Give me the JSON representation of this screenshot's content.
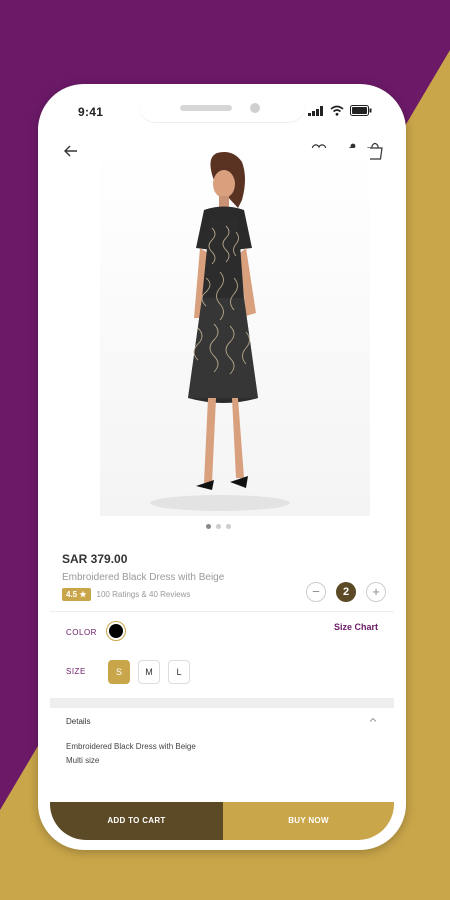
{
  "colors": {
    "background_purple": "#6c1a68",
    "gold": "#c9a64a",
    "dark_brown": "#5c4a26"
  },
  "status_bar": {
    "time": "9:41"
  },
  "header": {
    "back_icon": "arrow-left-icon",
    "icons": [
      "heart-icon",
      "share-icon",
      "shopping-bag-icon"
    ]
  },
  "gallery": {
    "image": "dress-model-photo",
    "dots": 3,
    "active_dot": 1
  },
  "product": {
    "price": "SAR 379.00",
    "name": "Embroidered Black Dress with Beige",
    "rating": "4.5 ★",
    "reviews": "100 Ratings & 40 Reviews"
  },
  "quantity": {
    "minus": "−",
    "value": "2",
    "plus": "+"
  },
  "color": {
    "label": "COLOR",
    "selected": "#000000",
    "size_chart": "Size Chart"
  },
  "size": {
    "label": "SIZE",
    "options": [
      "S",
      "M",
      "L"
    ],
    "selected": "S"
  },
  "details": {
    "title": "Details",
    "lines": [
      "Embroidered Black Dress with Beige",
      "Multi size"
    ]
  },
  "actions": {
    "add_to_cart": "ADD TO CART",
    "buy_now": "BUY NOW"
  }
}
